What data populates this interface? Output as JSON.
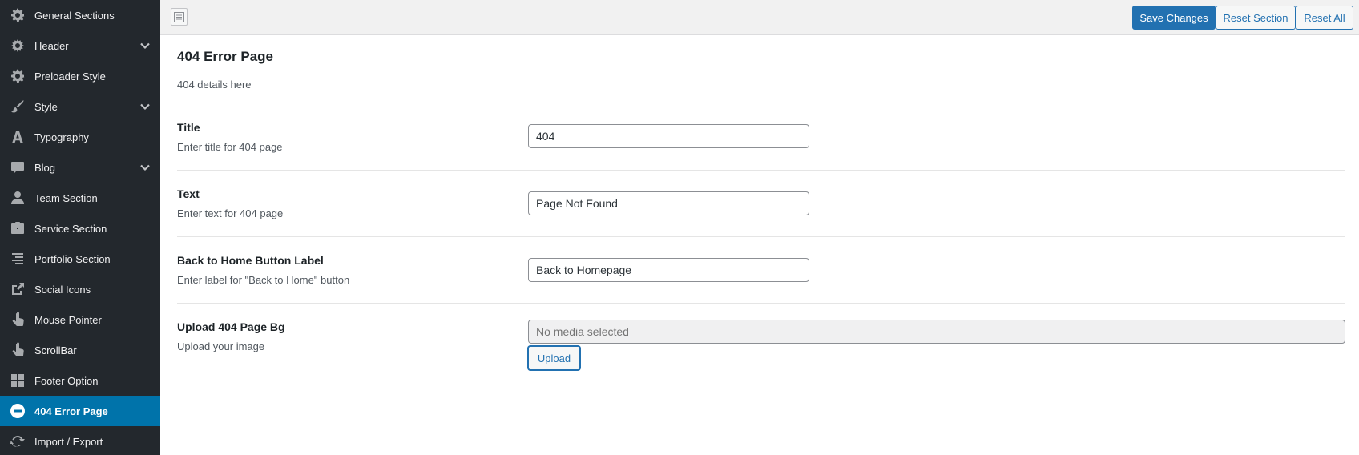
{
  "sidebar": {
    "items": [
      {
        "label": "General Sections",
        "icon": "gear-icon",
        "expandable": false,
        "active": false
      },
      {
        "label": "Header",
        "icon": "cog-icon",
        "expandable": true,
        "active": false
      },
      {
        "label": "Preloader Style",
        "icon": "gear-icon",
        "expandable": false,
        "active": false
      },
      {
        "label": "Style",
        "icon": "brush-icon",
        "expandable": true,
        "active": false
      },
      {
        "label": "Typography",
        "icon": "typography-icon",
        "expandable": false,
        "active": false
      },
      {
        "label": "Blog",
        "icon": "comment-icon",
        "expandable": true,
        "active": false
      },
      {
        "label": "Team Section",
        "icon": "user-icon",
        "expandable": false,
        "active": false
      },
      {
        "label": "Service Section",
        "icon": "briefcase-icon",
        "expandable": false,
        "active": false
      },
      {
        "label": "Portfolio Section",
        "icon": "align-right-icon",
        "expandable": false,
        "active": false
      },
      {
        "label": "Social Icons",
        "icon": "share-icon",
        "expandable": false,
        "active": false
      },
      {
        "label": "Mouse Pointer",
        "icon": "pointer-hand-icon",
        "expandable": false,
        "active": false
      },
      {
        "label": "ScrollBar",
        "icon": "pointer-hand-icon",
        "expandable": false,
        "active": false
      },
      {
        "label": "Footer Option",
        "icon": "grid-icon",
        "expandable": false,
        "active": false
      },
      {
        "label": "404 Error Page",
        "icon": "minus-circle-icon",
        "expandable": false,
        "active": true
      },
      {
        "label": "Import / Export",
        "icon": "refresh-icon",
        "expandable": false,
        "active": false
      }
    ]
  },
  "toolbar": {
    "save_label": "Save Changes",
    "reset_section_label": "Reset Section",
    "reset_all_label": "Reset All"
  },
  "section": {
    "title": "404 Error Page",
    "description": "404 details here"
  },
  "fields": {
    "title": {
      "label": "Title",
      "description": "Enter title for 404 page",
      "value": "404"
    },
    "text": {
      "label": "Text",
      "description": "Enter text for 404 page",
      "value": "Page Not Found"
    },
    "back_home": {
      "label": "Back to Home Button Label",
      "description": "Enter label for \"Back to Home\" button",
      "value": "Back to Homepage"
    },
    "upload_bg": {
      "label": "Upload 404 Page Bg",
      "description": "Upload your image",
      "placeholder": "No media selected",
      "button_label": "Upload"
    }
  },
  "colors": {
    "sidebar_bg": "#23282d",
    "active_bg": "#0073aa",
    "primary": "#2271b1"
  }
}
